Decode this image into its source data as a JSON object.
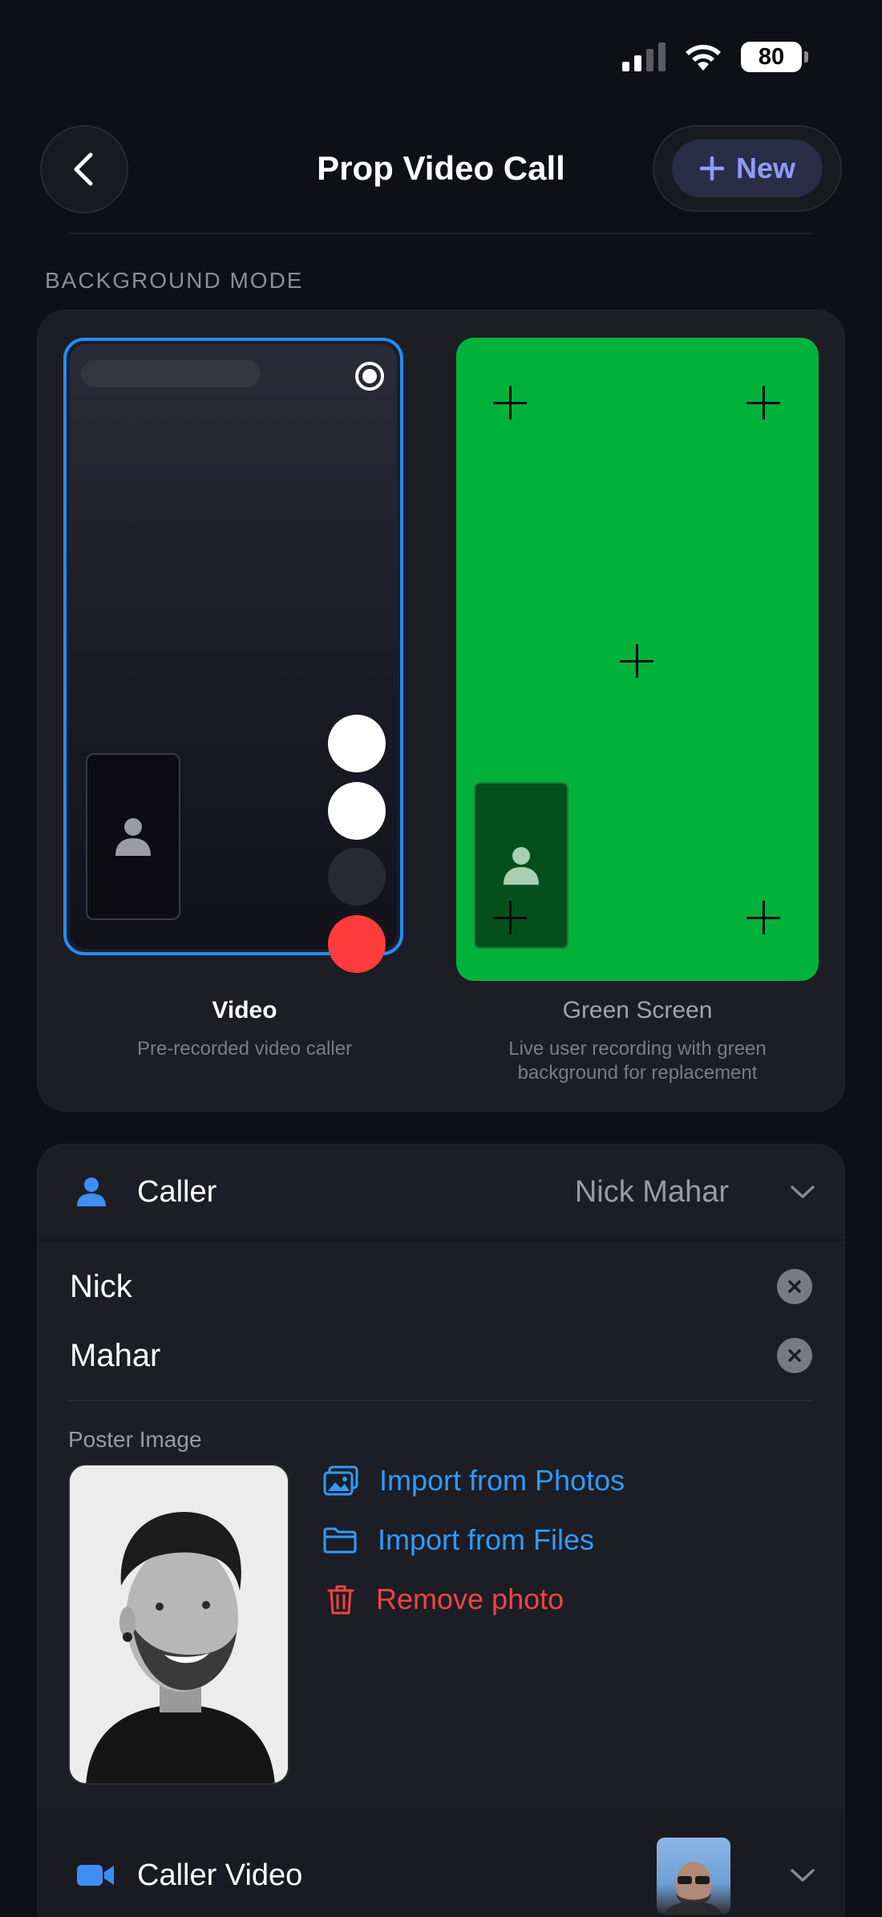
{
  "status_bar": {
    "battery": "80"
  },
  "header": {
    "title": "Prop Video Call",
    "new_label": "New"
  },
  "background_mode": {
    "section_label": "BACKGROUND MODE",
    "options": [
      {
        "title": "Video",
        "description": "Pre-recorded video caller",
        "selected": true
      },
      {
        "title": "Green Screen",
        "description": "Live user recording with green background for replacement",
        "selected": false
      }
    ]
  },
  "caller": {
    "label": "Caller",
    "value": "Nick Mahar",
    "first_name": "Nick",
    "last_name": "Mahar",
    "poster_label": "Poster Image",
    "actions": {
      "import_photos": "Import from Photos",
      "import_files": "Import from Files",
      "remove_photo": "Remove photo"
    }
  },
  "caller_video": {
    "label": "Caller Video"
  },
  "colors": {
    "accent_blue": "#1f8fff",
    "green_screen": "#00b23a",
    "destructive": "#ef4444",
    "end_call_red": "#ff3b3b"
  },
  "icons": [
    "chevron-left-icon",
    "plus-icon",
    "person-icon",
    "chevron-down-icon",
    "clear-icon",
    "photos-icon",
    "folder-icon",
    "trash-icon",
    "video-camera-icon",
    "signal-icon",
    "wifi-icon",
    "battery-icon"
  ]
}
